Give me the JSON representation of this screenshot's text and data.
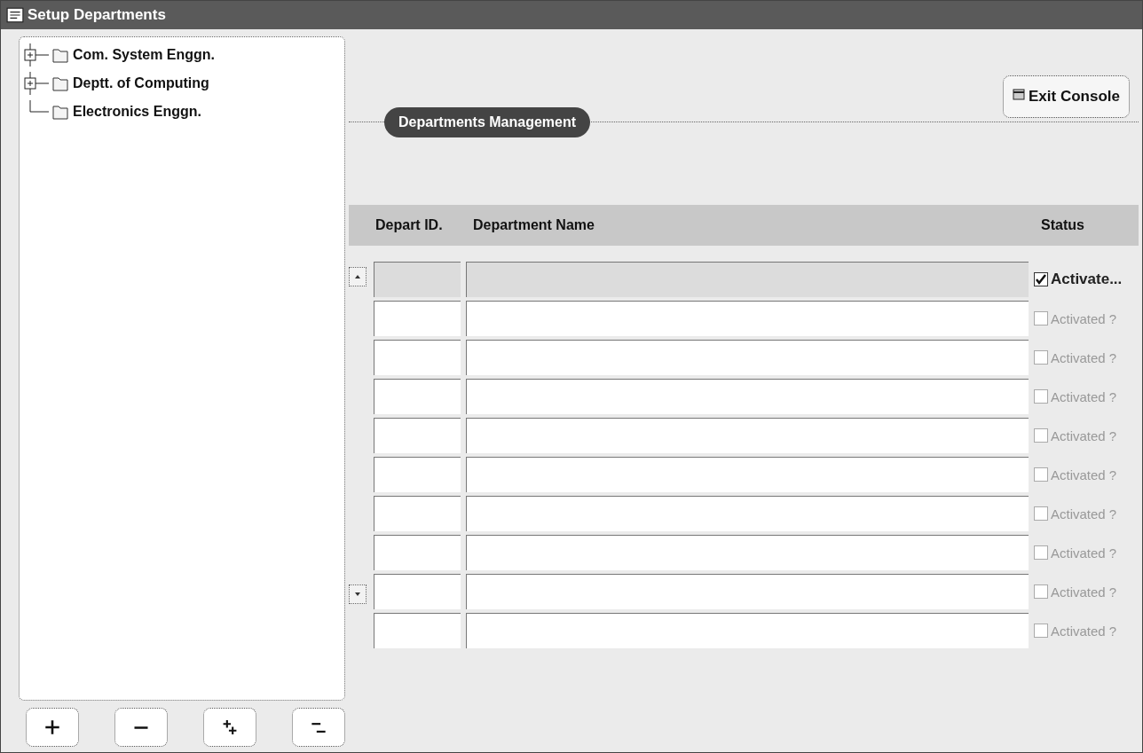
{
  "window": {
    "title": "Setup Departments"
  },
  "tree": [
    {
      "label": "Com. System Enggn.",
      "collapsed": true
    },
    {
      "label": "Deptt. of Computing",
      "collapsed": true
    },
    {
      "label": "Electronics Enggn.",
      "collapsed": false
    }
  ],
  "tree_buttons": [
    {
      "kind": "expand"
    },
    {
      "kind": "collapse"
    },
    {
      "kind": "expand_all"
    },
    {
      "kind": "collapse_all"
    }
  ],
  "exit_button": "Exit Console",
  "section_title": "Departments Management",
  "table": {
    "columns": [
      "Depart ID.",
      "Department Name",
      "Status"
    ],
    "rows": [
      {
        "selected": true,
        "checked": true,
        "disabled": false,
        "status": "Activate..."
      },
      {
        "selected": false,
        "checked": false,
        "disabled": true,
        "status": "Activated ?"
      },
      {
        "selected": false,
        "checked": false,
        "disabled": true,
        "status": "Activated ?"
      },
      {
        "selected": false,
        "checked": false,
        "disabled": true,
        "status": "Activated ?"
      },
      {
        "selected": false,
        "checked": false,
        "disabled": true,
        "status": "Activated ?"
      },
      {
        "selected": false,
        "checked": false,
        "disabled": true,
        "status": "Activated ?"
      },
      {
        "selected": false,
        "checked": false,
        "disabled": true,
        "status": "Activated ?"
      },
      {
        "selected": false,
        "checked": false,
        "disabled": true,
        "status": "Activated ?"
      },
      {
        "selected": false,
        "checked": false,
        "disabled": true,
        "status": "Activated ?"
      },
      {
        "selected": false,
        "checked": false,
        "disabled": true,
        "status": "Activated ?"
      }
    ]
  }
}
